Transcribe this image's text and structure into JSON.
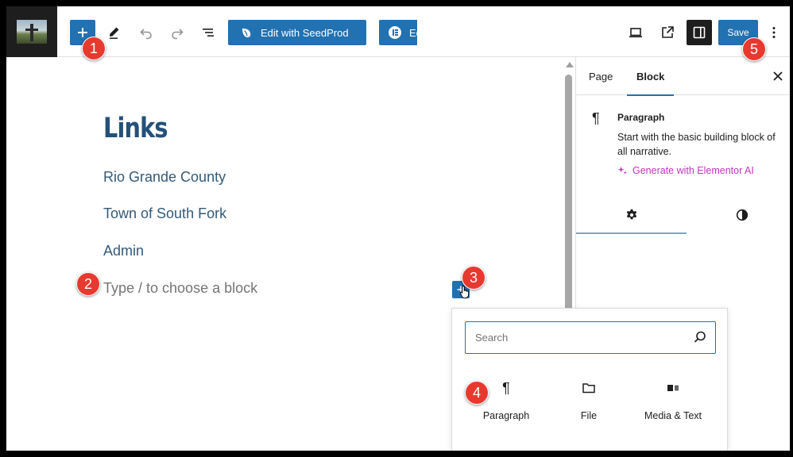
{
  "toolbar": {
    "seedprod_label": "Edit with SeedProd",
    "elementor_label": "Edit with Elementor",
    "save_label": "Save"
  },
  "canvas": {
    "title": "Links",
    "links": [
      "Rio Grande County",
      "Town of South Fork",
      "Admin"
    ],
    "placeholder": "Type / to choose a block"
  },
  "sidebar": {
    "tabs": [
      {
        "label": "Page"
      },
      {
        "label": "Block"
      }
    ],
    "active_tab": "Block",
    "block_name": "Paragraph",
    "block_description": "Start with the basic building block of all narrative.",
    "ai_link": "Generate with Elementor AI"
  },
  "inserter": {
    "search_placeholder": "Search",
    "items": [
      {
        "label": "Paragraph",
        "icon": "paragraph-icon"
      },
      {
        "label": "File",
        "icon": "folder-icon"
      },
      {
        "label": "Media & Text",
        "icon": "media-text-icon"
      }
    ]
  },
  "callouts": [
    "1",
    "2",
    "3",
    "4",
    "5"
  ],
  "colors": {
    "accent": "#2271b1",
    "title": "#24507a",
    "link": "#335a78",
    "ai": "#c036c0",
    "callout": "#e8392f"
  }
}
